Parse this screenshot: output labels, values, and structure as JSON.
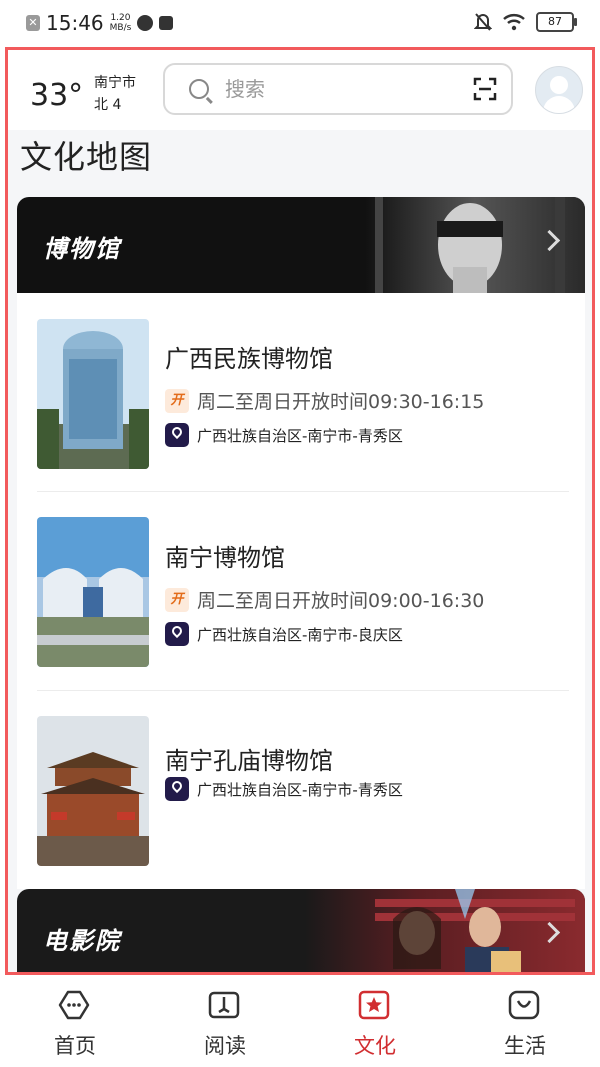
{
  "status_bar": {
    "time": "15:46",
    "net_speed_top": "1.20",
    "net_speed_bottom": "MB/s",
    "battery": "87"
  },
  "header": {
    "temperature": "33°",
    "city": "南宁市",
    "wind": "北 4",
    "search_placeholder": "搜索"
  },
  "section_title": "文化地图",
  "museum_banner": {
    "label": "博物馆"
  },
  "museums": [
    {
      "name": "广西民族博物馆",
      "badge": "开",
      "hours": "周二至周日开放时间09:30-16:15",
      "address": "广西壮族自治区-南宁市-青秀区"
    },
    {
      "name": "南宁博物馆",
      "badge": "开",
      "hours": "周二至周日开放时间09:00-16:30",
      "address": "广西壮族自治区-南宁市-良庆区"
    },
    {
      "name": "南宁孔庙博物馆",
      "address": "广西壮族自治区-南宁市-青秀区"
    }
  ],
  "cinema_banner": {
    "label": "电影院"
  },
  "tabbar": {
    "tabs": [
      {
        "label": "首页",
        "icon": "home-icon"
      },
      {
        "label": "阅读",
        "icon": "book-icon"
      },
      {
        "label": "文化",
        "icon": "culture-star-icon",
        "active": true
      },
      {
        "label": "生活",
        "icon": "life-bag-icon"
      }
    ]
  },
  "colors": {
    "frame": "#f25a5c",
    "active_tab": "#d12e31",
    "pin_badge": "#221b4a",
    "open_badge": "#e36c1b"
  }
}
